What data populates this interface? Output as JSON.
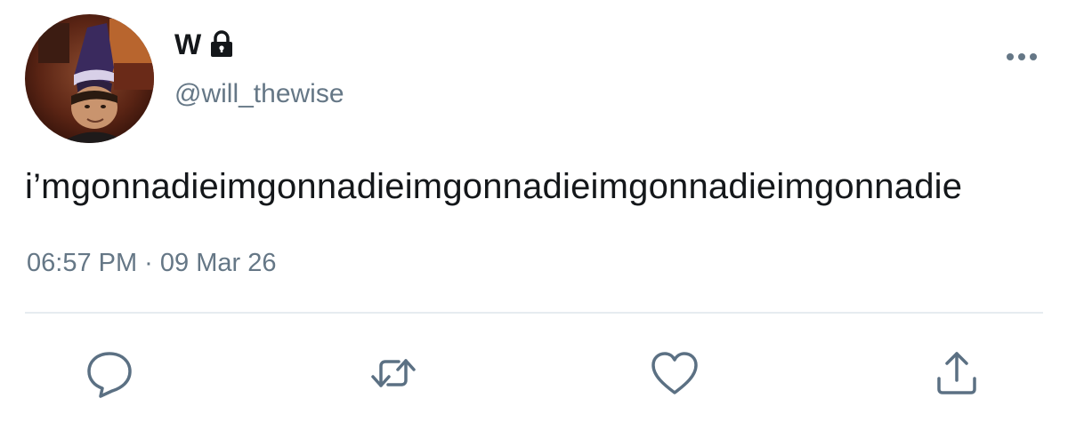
{
  "tweet": {
    "author": {
      "display_name": "W",
      "handle": "@will_thewise",
      "protected_icon": "lock-icon",
      "avatar": "profile-photo"
    },
    "text": "i’mgonnadieimgonnadieimgonnadieimgonnadieimgonnadie",
    "timestamp": "06:57 PM · 09 Mar 26",
    "more_icon": "more-horizontal-icon"
  },
  "actions": [
    {
      "name": "reply",
      "icon": "reply-icon"
    },
    {
      "name": "retweet",
      "icon": "retweet-icon"
    },
    {
      "name": "like",
      "icon": "heart-icon"
    },
    {
      "name": "share",
      "icon": "share-icon"
    }
  ],
  "colors": {
    "text_primary": "#14171a",
    "text_secondary": "#657786",
    "icon": "#5b7083",
    "divider": "#e6ecf0"
  }
}
